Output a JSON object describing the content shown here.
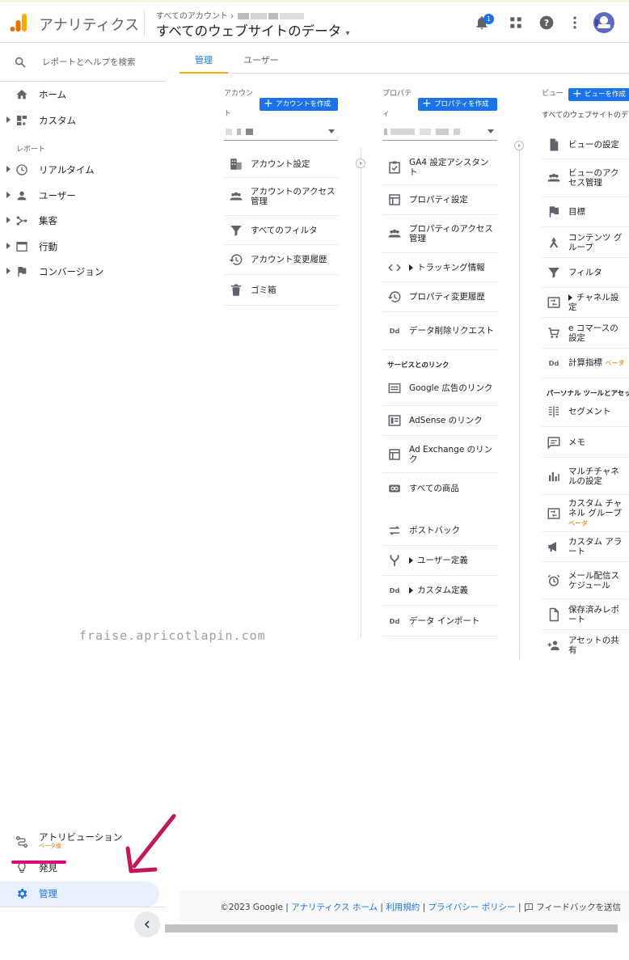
{
  "header": {
    "app_name": "アナリティクス",
    "breadcrumb": "すべてのアカウント",
    "view_title": "すべてのウェブサイトのデータ",
    "notifications_count": "1",
    "icons": [
      "bell-icon",
      "apps-icon",
      "help-icon",
      "more-vert-icon",
      "avatar"
    ]
  },
  "sidebar": {
    "search_placeholder": "レポートとヘルプを検索",
    "home": "ホーム",
    "custom": "カスタム",
    "reports_label": "レポート",
    "realtime": "リアルタイム",
    "audience": "ユーザー",
    "acquisition": "集客",
    "behavior": "行動",
    "conversions": "コンバージョン",
    "attribution": "アトリビューション",
    "attribution_badge": "ベータ版",
    "discover": "発見",
    "admin": "管理"
  },
  "tabs": {
    "admin": "管理",
    "user": "ユーザー"
  },
  "account": {
    "header": "アカウント",
    "create": "アカウントを作成",
    "items": [
      "アカウント設定",
      "アカウントのアクセス管理",
      "すべてのフィルタ",
      "アカウント変更履歴",
      "ゴミ箱"
    ]
  },
  "property": {
    "header": "プロパティ",
    "create": "プロパティを作成",
    "items": [
      "GA4 設定アシスタント",
      "プロパティ設定",
      "プロパティのアクセス管理",
      "トラッキング情報",
      "プロパティ変更履歴",
      "データ削除リクエスト"
    ],
    "links_header": "サービスとのリンク",
    "link_items": [
      "Google 広告のリンク",
      "AdSense のリンク",
      "Ad Exchange のリンク",
      "すべての商品"
    ],
    "other_items": [
      "ポストバック",
      "ユーザー定義",
      "カスタム定義",
      "データ インポート"
    ]
  },
  "view": {
    "header": "ビュー",
    "create": "ビューを作成",
    "selected": "すべてのウェブサイトのデータ",
    "items": [
      "ビューの設定",
      "ビューのアクセス管理",
      "目標",
      "コンテンツ グループ",
      "フィルタ",
      "チャネル設定",
      "e コマースの設定",
      "計算指標"
    ],
    "beta": "ベータ",
    "personal_header": "パーソナル ツールとアセット",
    "personal_items": [
      "セグメント",
      "メモ",
      "マルチチャネルの設定",
      "カスタム チャネル グループ",
      "カスタム アラート",
      "メール配信スケジュール",
      "保存済みレポート",
      "アセットの共有"
    ]
  },
  "watermark": "fraise.apricotlapin.com",
  "footer": {
    "copyright": "©2023 Google",
    "home": "アナリティクス ホーム",
    "terms": "利用規約",
    "privacy": "プライバシー ポリシー",
    "feedback": "フィードバックを送信"
  },
  "colors": {
    "accent": "#1a73e8",
    "tab_underline": "#f9ab00",
    "annotation": "#c2185b",
    "highlight": "#e0007a"
  }
}
